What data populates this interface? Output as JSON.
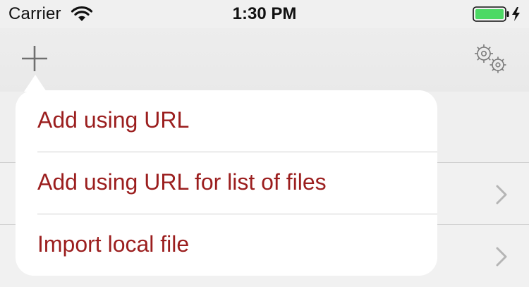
{
  "status_bar": {
    "carrier": "Carrier",
    "time": "1:30 PM"
  },
  "nav_bar": {
    "left_icon": "plus-icon",
    "right_icon": "gears-icon"
  },
  "popover": {
    "items": [
      {
        "label": "Add using URL"
      },
      {
        "label": "Add using URL for list of files"
      },
      {
        "label": "Import local file"
      }
    ]
  },
  "colors": {
    "accent": "#9b1e1e",
    "battery": "#4cd964"
  }
}
